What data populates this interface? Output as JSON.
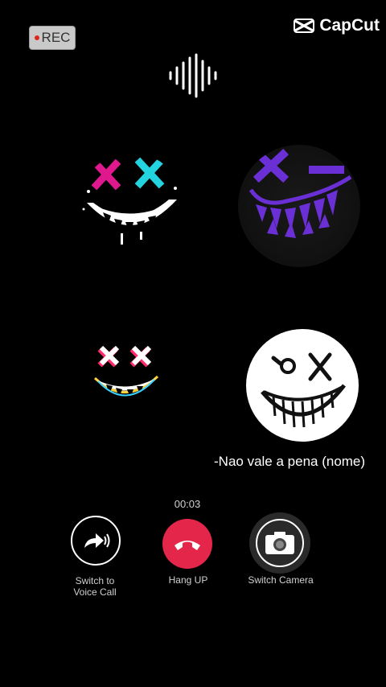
{
  "recording": {
    "label": "REC"
  },
  "watermark": {
    "label": "CapCut",
    "icon": "capcut-logo-icon"
  },
  "audio": {
    "icon": "sound-wave-icon"
  },
  "participants": [
    {
      "icon": "xx-eyes-neon-smiley-avatar"
    },
    {
      "icon": "purple-wink-smiley-avatar"
    },
    {
      "icon": "glitch-xx-smiley-avatar"
    },
    {
      "icon": "ox-grin-smiley-avatar"
    }
  ],
  "caller": {
    "name": "-Nao vale a pena (nome)"
  },
  "call": {
    "duration": "00:03"
  },
  "controls": {
    "voice": {
      "label_line1": "Switch to",
      "label_line2": "Voice Call",
      "icon": "forward-call-icon"
    },
    "hangup": {
      "label": "Hang UP",
      "icon": "phone-hangup-icon",
      "color": "#e5264b"
    },
    "camera": {
      "label": "Switch Camera",
      "icon": "camera-icon"
    }
  }
}
